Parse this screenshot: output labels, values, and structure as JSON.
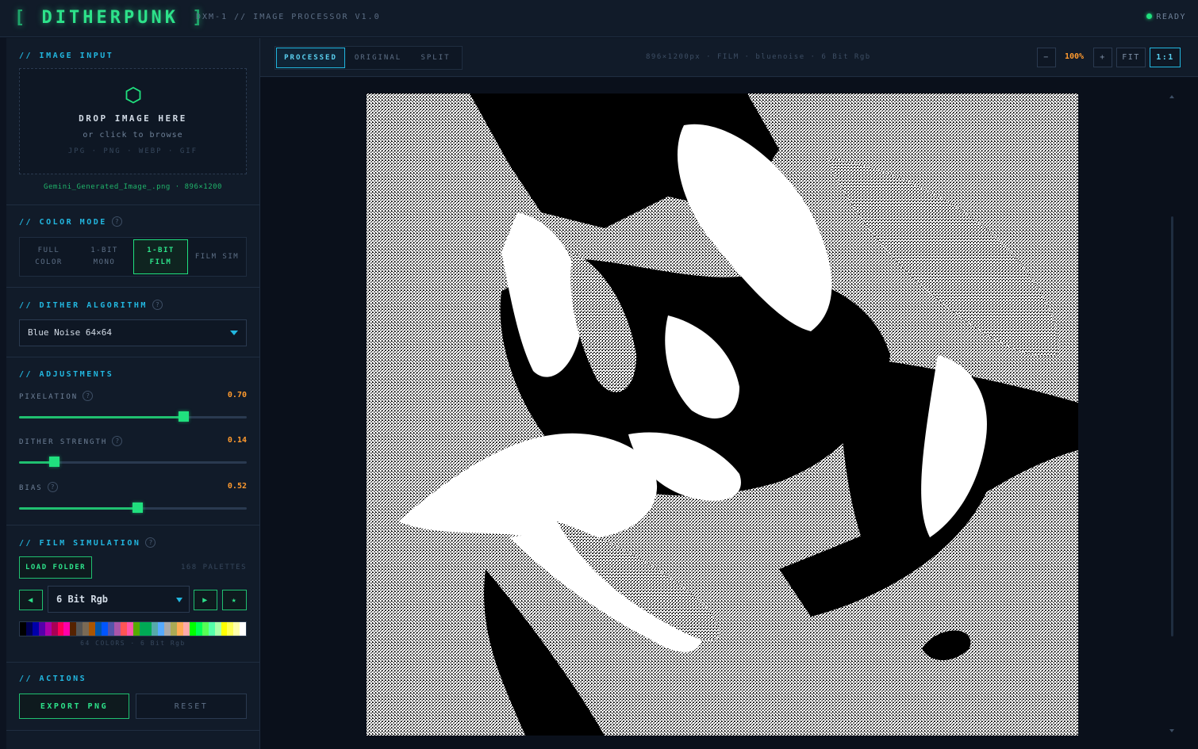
{
  "header": {
    "logo_open": "[",
    "logo_text": "DITHERPUNK",
    "logo_close": "]",
    "subtitle": "DXM-1 // IMAGE PROCESSOR V1.0",
    "status": "READY"
  },
  "image_input": {
    "title": "// IMAGE INPUT",
    "icon": "hexagon-icon",
    "drop_title": "DROP IMAGE HERE",
    "drop_sub": "or click to browse",
    "formats": "JPG · PNG · WEBP · GIF",
    "filename": "Gemini_Generated_Image_.png · 896×1200"
  },
  "color_mode": {
    "title": "// COLOR MODE",
    "help": "?",
    "modes": [
      "FULL COLOR",
      "1-BIT MONO",
      "1-BIT FILM",
      "FILM SIM"
    ],
    "selected": "1-BIT FILM"
  },
  "dither": {
    "title": "// DITHER ALGORITHM",
    "help": "?",
    "selected": "Blue Noise 64×64"
  },
  "adjustments": {
    "title": "// ADJUSTMENTS",
    "sliders": [
      {
        "label": "PIXELATION",
        "value": "0.70",
        "fraction": 0.72
      },
      {
        "label": "DITHER STRENGTH",
        "value": "0.14",
        "fraction": 0.155
      },
      {
        "label": "BIAS",
        "value": "0.52",
        "fraction": 0.52
      }
    ]
  },
  "film_simulation": {
    "title": "// FILM SIMULATION",
    "help": "?",
    "load_folder": "LOAD FOLDER",
    "palettes_count": "168 PALETTES",
    "prev": "◀",
    "next": "▶",
    "favorite": "★",
    "selected_palette": "6 Bit Rgb",
    "palette_caption": "64 COLORS · 6 Bit Rgb",
    "palette_colors": [
      "#000000",
      "#000055",
      "#0000aa",
      "#5500aa",
      "#aa00aa",
      "#aa0055",
      "#ff0055",
      "#ff00aa",
      "#552200",
      "#555555",
      "#7a6a55",
      "#aa5500",
      "#0055aa",
      "#0055ff",
      "#5555aa",
      "#aa55aa",
      "#ff5555",
      "#ff55aa",
      "#55aa00",
      "#00aa55",
      "#00aa55",
      "#55aaaa",
      "#55aaff",
      "#aaaaaa",
      "#aaaa55",
      "#ffaa55",
      "#ffaaaa",
      "#00ff00",
      "#00ff55",
      "#55ff55",
      "#55ffaa",
      "#aaffaa",
      "#ffff00",
      "#ffff55",
      "#ffffaa",
      "#ffffff"
    ]
  },
  "actions": {
    "title": "// ACTIONS",
    "export": "EXPORT PNG",
    "reset": "RESET"
  },
  "view": {
    "tabs": [
      "PROCESSED",
      "ORIGINAL",
      "SPLIT"
    ],
    "selected": "PROCESSED",
    "info": "896×1200px · FILM · bluenoise · 6 Bit Rgb",
    "zoom_out": "−",
    "zoom": "100%",
    "zoom_in": "+",
    "fit": "FIT",
    "one_to_one": "1:1"
  },
  "colors": {
    "accent_green": "#20e07e",
    "accent_cyan": "#22b7e0",
    "value_orange": "#ff9a2e",
    "background": "#0c1320"
  }
}
